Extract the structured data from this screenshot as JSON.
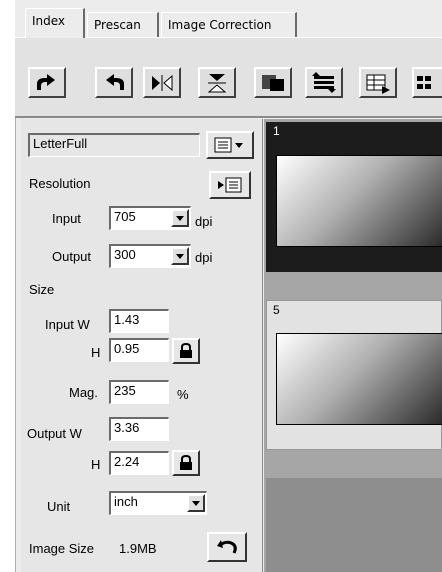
{
  "tabs": [
    {
      "label": "Index",
      "active": true
    },
    {
      "label": "Prescan",
      "active": false
    },
    {
      "label": "Image Correction",
      "active": false
    }
  ],
  "toolbar": {
    "buttons": [
      "rotate-left-icon",
      "rotate-right-icon",
      "flip-horizontal-icon",
      "flip-vertical-icon",
      "frame-icon",
      "swap-icon",
      "table-icon",
      "grid-icon"
    ]
  },
  "panel": {
    "preset_value": "LetterFull",
    "resolution_label": "Resolution",
    "input_label": "Input",
    "input_value": "705",
    "input_unit": "dpi",
    "output_label": "Output",
    "output_value": "300",
    "output_unit": "dpi",
    "size_label": "Size",
    "input_w_label": "Input W",
    "input_w_value": "1.43",
    "input_h_label": "H",
    "input_h_value": "0.95",
    "mag_label": "Mag.",
    "mag_value": "235",
    "mag_unit": "%",
    "output_w_label": "Output W",
    "output_w_value": "3.36",
    "output_h_label": "H",
    "output_h_value": "2.24",
    "unit_label": "Unit",
    "unit_value": "inch",
    "image_size_label": "Image Size",
    "image_size_value": "1.9MB"
  },
  "thumbnails": [
    {
      "number": "1",
      "selected": true
    },
    {
      "number": "5",
      "selected": false
    }
  ]
}
